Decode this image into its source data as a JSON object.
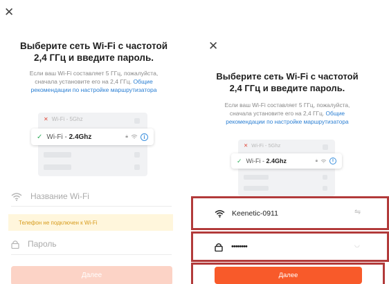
{
  "left": {
    "close_icon": "✕",
    "title_line1": "Выберите сеть Wi-Fi с частотой",
    "title_line2": "2,4 ГГц и введите пароль.",
    "subtitle_line1": "Если ваш Wi-Fi составляет 5 ГГц, пожалуйста,",
    "subtitle_line2_prefix": "сначала установите его на 2,4 ГГц.",
    "subtitle_line2_link": "Общие",
    "subtitle_line3_link": "рекомендации по настройке маршрутизатора",
    "illustration": {
      "row_5g_label": "Wi-Fi - 5Ghz",
      "row_24_prefix": "Wi-Fi - ",
      "row_24_bold": "2.4Ghz"
    },
    "wifi_field_placeholder": "Название Wi-Fi",
    "warning_text": "Телефон не подключен к Wi-Fi",
    "password_placeholder": "Пароль",
    "button_label": "Далее"
  },
  "right": {
    "close_icon": "✕",
    "title_line1": "Выберите сеть Wi-Fi с частотой",
    "title_line2": "2,4 ГГц и введите пароль.",
    "subtitle_line1": "Если ваш Wi-Fi составляет 5 ГГц, пожалуйста,",
    "subtitle_line2_prefix": "сначала установите его на 2,4 ГГц.",
    "subtitle_line2_link": "Общие",
    "subtitle_line3_link": "рекомендации по настройке маршрутизатора",
    "illustration": {
      "row_5g_label": "Wi-Fi - 5Ghz",
      "row_24_prefix": "Wi-Fi - ",
      "row_24_bold": "2.4Ghz"
    },
    "wifi_value": "Keenetic-0911",
    "password_value": "••••••••",
    "button_label": "Далее"
  },
  "colors": {
    "accent": "#f85a2a",
    "highlight_box": "#b23a3a",
    "link": "#2b7fd3",
    "warning_bg": "#fff6dc"
  }
}
